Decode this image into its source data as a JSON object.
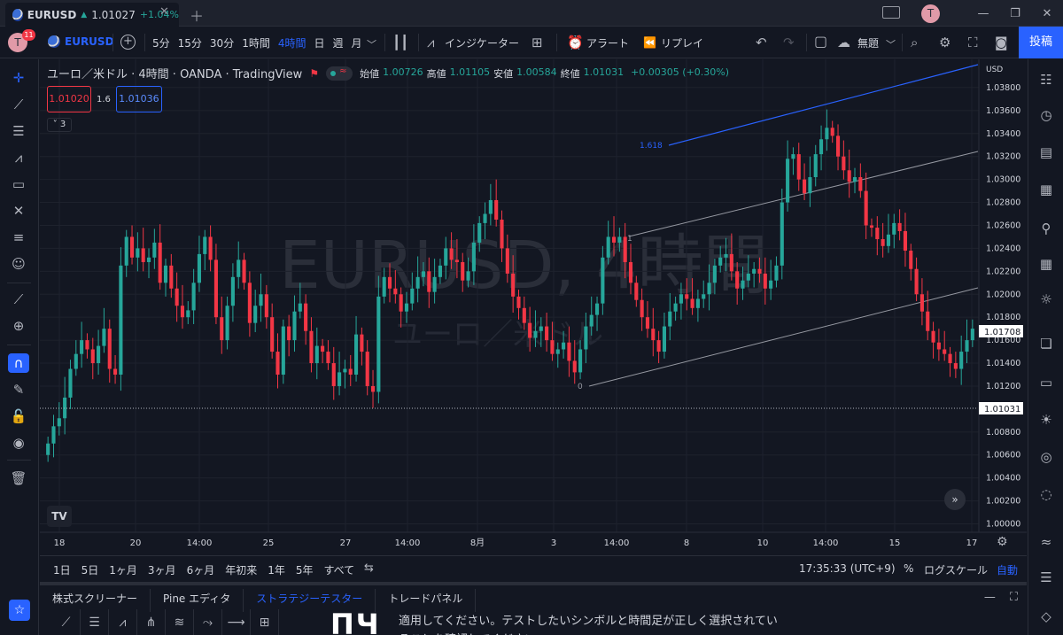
{
  "window": {
    "tab": {
      "symbol": "EURUSD",
      "price": "1.01027",
      "change": "+1.04%",
      "up_marker": "▲"
    },
    "avatar_letter": "T"
  },
  "toolbar": {
    "avatar_letter": "T",
    "badge": "11",
    "symbol": "EURUSD",
    "intervals": [
      "5分",
      "15分",
      "30分",
      "1時間",
      "4時間",
      "日",
      "週",
      "月"
    ],
    "active_interval": "4時間",
    "indicators": "インジケーター",
    "alert": "アラート",
    "replay": "リプレイ",
    "layout": "無題",
    "post": "投稿"
  },
  "legend": {
    "title": "ユーロ／米ドル · 4時間 · OANDA · TradingView",
    "ohlc": [
      {
        "k": "始値",
        "v": "1.00726"
      },
      {
        "k": "高値",
        "v": "1.01105"
      },
      {
        "k": "安値",
        "v": "1.00584"
      },
      {
        "k": "終値",
        "v": "1.01031"
      },
      {
        "k": "",
        "v": "+0.00305 (+0.30%)"
      }
    ],
    "bid": "1.01020",
    "spread": "1.6",
    "ask": "1.01036",
    "collapsed_count": "3"
  },
  "watermark": {
    "line1": "EURUSD, 4時間",
    "line2": "ユーロ／米ドル"
  },
  "price_axis": {
    "currency": "USD",
    "ticks": [
      "1.03800",
      "1.03600",
      "1.03400",
      "1.03200",
      "1.03000",
      "1.02800",
      "1.02600",
      "1.02400",
      "1.02200",
      "1.02000",
      "1.01800",
      "1.01600",
      "1.01400",
      "1.01200",
      "1.00800",
      "1.00600",
      "1.00400",
      "1.00200",
      "1.00000"
    ],
    "current_label": "1.01708",
    "crosshair_label": "1.01031"
  },
  "time_axis": {
    "ticks": [
      "18",
      "20",
      "14:00",
      "25",
      "27",
      "14:00",
      "8月",
      "3",
      "14:00",
      "8",
      "10",
      "14:00",
      "15",
      "17"
    ]
  },
  "fib": {
    "level_top": "1.618",
    "level_mid": "1",
    "level_bottom": "0"
  },
  "colors": {
    "up": "#26a69a",
    "down": "#f23645",
    "accent": "#2962ff",
    "bg": "#131722"
  },
  "ranges": [
    "1日",
    "5日",
    "1ヶ月",
    "3ヶ月",
    "6ヶ月",
    "年初来",
    "1年",
    "5年",
    "すべて"
  ],
  "rangebar": {
    "clock": "17:35:33 (UTC+9)",
    "pct": "%",
    "log": "ログスケール",
    "auto": "自動"
  },
  "bottom": {
    "tabs": [
      "株式スクリーナー",
      "Pine エディタ",
      "ストラテジーテスター",
      "トレードパネル"
    ],
    "active_tab": "ストラテジーテスター",
    "big_text": "ПЧ",
    "message": "適用してください。テストしたいシンボルと時間足が正しく選択されていることを確認してください"
  },
  "chart_data": {
    "type": "candlestick",
    "title": "ユーロ／米ドル · 4時間 · OANDA · TradingView",
    "symbol": "EURUSD",
    "interval": "4時間",
    "ylim": [
      0.9995,
      1.04
    ],
    "x_labels": [
      "18",
      "20",
      "14:00",
      "25",
      "27",
      "14:00",
      "8月",
      "3",
      "14:00",
      "8",
      "10",
      "14:00",
      "15",
      "17"
    ],
    "last_ohlc": {
      "open": 1.00726,
      "high": 1.01105,
      "low": 1.00584,
      "close": 1.01031
    },
    "current_price": 1.01708,
    "closes": [
      1.007,
      1.0085,
      1.0092,
      1.011,
      1.0135,
      1.0148,
      1.016,
      1.0152,
      1.014,
      1.0155,
      1.017,
      1.0135,
      1.013,
      1.0225,
      1.025,
      1.0232,
      1.024,
      1.0228,
      1.0232,
      1.0245,
      1.021,
      1.0225,
      1.0205,
      1.019,
      1.018,
      1.0186,
      1.021,
      1.0235,
      1.025,
      1.023,
      1.018,
      1.016,
      1.019,
      1.0215,
      1.023,
      1.021,
      1.0175,
      1.019,
      1.02,
      1.018,
      1.015,
      1.013,
      1.0172,
      1.016,
      1.0185,
      1.0192,
      1.0168,
      1.014,
      1.0155,
      1.015,
      1.014,
      1.012,
      1.0132,
      1.0135,
      1.013,
      1.0165,
      1.015,
      1.012,
      1.0115,
      1.0198,
      1.0215,
      1.0205,
      1.02,
      1.0185,
      1.0192,
      1.0205,
      1.0215,
      1.022,
      1.0202,
      1.0215,
      1.0225,
      1.024,
      1.023,
      1.0228,
      1.0212,
      1.022,
      1.0245,
      1.0262,
      1.027,
      1.0282,
      1.0265,
      1.024,
      1.0218,
      1.0198,
      1.0188,
      1.0175,
      1.0162,
      1.0168,
      1.0172,
      1.016,
      1.0148,
      1.0152,
      1.0158,
      1.0142,
      1.0132,
      1.0152,
      1.0172,
      1.0182,
      1.0192,
      1.0232,
      1.025,
      1.0245,
      1.025,
      1.0228,
      1.021,
      1.0195,
      1.018,
      1.017,
      1.016,
      1.015,
      1.0172,
      1.0185,
      1.0192,
      1.02,
      1.0196,
      1.0188,
      1.0196,
      1.02,
      1.021,
      1.0225,
      1.0232,
      1.0235,
      1.022,
      1.0205,
      1.0212,
      1.0218,
      1.0222,
      1.0218,
      1.0205,
      1.0212,
      1.0225,
      1.028,
      1.0318,
      1.0322,
      1.03,
      1.0288,
      1.0302,
      1.0322,
      1.0335,
      1.0345,
      1.0338,
      1.032,
      1.0308,
      1.0298,
      1.0302,
      1.029,
      1.026,
      1.0258,
      1.0248,
      1.0242,
      1.0252,
      1.0262,
      1.0255,
      1.0238,
      1.0222,
      1.02,
      1.0185,
      1.0168,
      1.0158,
      1.0152,
      1.0148,
      1.014,
      1.0135,
      1.015,
      1.016,
      1.017
    ]
  }
}
